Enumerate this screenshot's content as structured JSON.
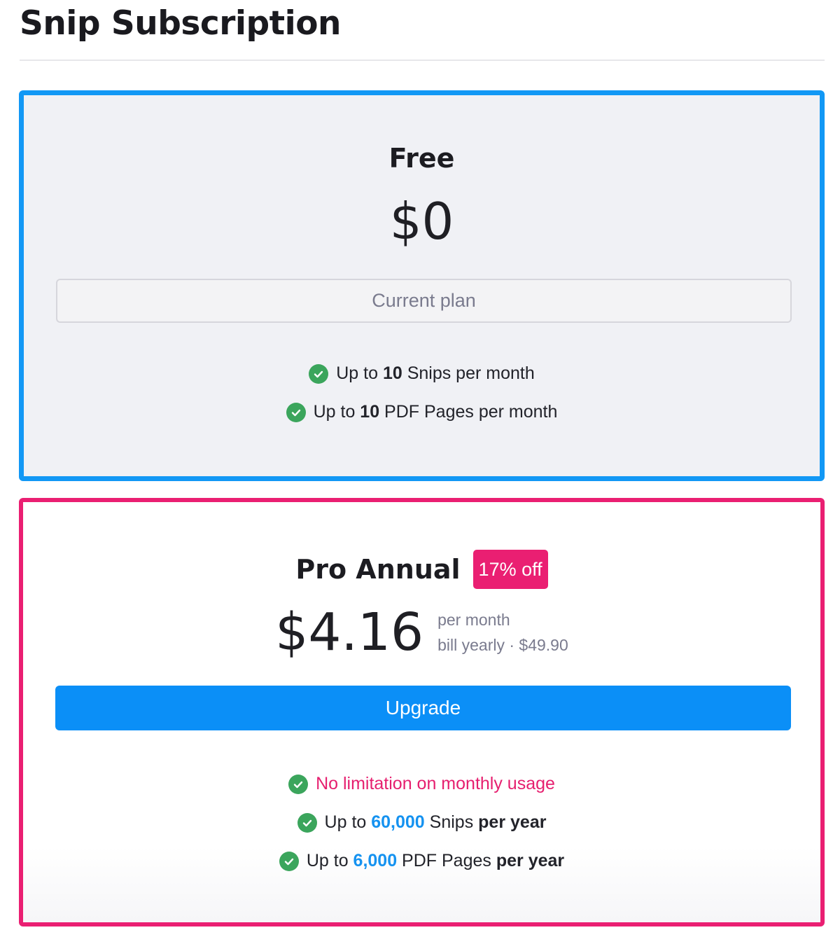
{
  "page": {
    "title": "Snip Subscription"
  },
  "plans": {
    "free": {
      "name": "Free",
      "price": "$0",
      "button_label": "Current plan",
      "features": [
        {
          "prefix": "Up to ",
          "value": "10",
          "suffix": " Snips per month"
        },
        {
          "prefix": "Up to ",
          "value": "10",
          "suffix": " PDF Pages per month"
        }
      ],
      "border_color": "#1298f5"
    },
    "pro": {
      "name": "Pro Annual",
      "badge": "17% off",
      "price": "$4.16",
      "price_period": "per month",
      "billing_note": "bill yearly · $49.90",
      "button_label": "Upgrade",
      "features": [
        {
          "text": "No limitation on monthly usage"
        },
        {
          "prefix": "Up to ",
          "value": "60,000",
          "middle": " Snips ",
          "emphasis": "per year"
        },
        {
          "prefix": "Up to ",
          "value": "6,000",
          "middle": " PDF Pages ",
          "emphasis": "per year"
        }
      ],
      "border_color": "#ea1f72",
      "button_color": "#0b8ff7"
    }
  },
  "icons": {
    "feature_check": "check-circle-icon",
    "check_color": "#3ba55c"
  }
}
